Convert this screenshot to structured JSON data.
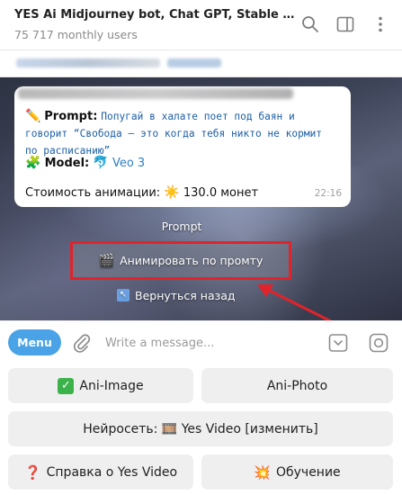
{
  "header": {
    "title": "YES Ai Midjourney bot, Chat GPT, Stable Diffusion...",
    "subtitle": "75 717 monthly users",
    "icons": [
      "search-icon",
      "sidebar-toggle-icon",
      "more-icon"
    ]
  },
  "message": {
    "prompt_label": "Prompt:",
    "prompt_text": "Попугай в халате поет под баян и говорит “Свобода — это когда тебя никто не кормит по расписанию”",
    "model_label": "Model:",
    "model_value": "Veo 3",
    "cost_label": "Стоимость анимации:",
    "cost_value": "130.0 монет",
    "time": "22:16"
  },
  "inline": {
    "title": "Prompt",
    "animate_button": "Анимировать по промту",
    "back_button": "Вернуться назад"
  },
  "composer": {
    "menu_label": "Menu",
    "placeholder": "Write a message..."
  },
  "keyboard": {
    "ani_image": "Ani-Image",
    "ani_photo": "Ani-Photo",
    "neuro": "Нейросеть: 🎞️ Yes Video [изменить]",
    "help": "Справка о Yes Video",
    "training": "Обучение"
  },
  "colors": {
    "accent": "#4aa3e6",
    "highlight": "#e2232a"
  }
}
